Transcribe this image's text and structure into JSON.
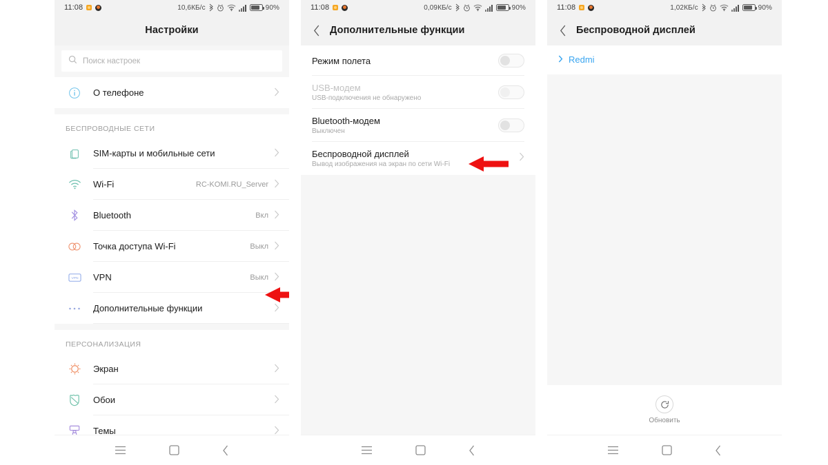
{
  "statusbar": {
    "time": "11:08",
    "battery_pct": "90%",
    "net_speed_1": "10,6КБ/c",
    "net_speed_2": "0,09КБ/c",
    "net_speed_3": "1,02КБ/c",
    "icons": [
      "bluetooth-icon",
      "alarm-icon",
      "wifi-icon",
      "signal-icon",
      "battery-icon"
    ]
  },
  "panel1": {
    "title": "Настройки",
    "search_placeholder": "Поиск настроек",
    "about": {
      "label": "О телефоне",
      "icon": "info-icon",
      "value": "",
      "chevron": "›"
    },
    "section_wireless": "БЕСПРОВОДНЫЕ СЕТИ",
    "wireless_items": [
      {
        "label": "SIM-карты и мобильные сети",
        "value": "",
        "icon": "sim-card-icon"
      },
      {
        "label": "Wi-Fi",
        "value": "RC-KOMI.RU_Server",
        "icon": "wifi-icon"
      },
      {
        "label": "Bluetooth",
        "value": "Вкл",
        "icon": "bluetooth-icon"
      },
      {
        "label": "Точка доступа Wi-Fi",
        "value": "Выкл",
        "icon": "hotspot-icon"
      },
      {
        "label": "VPN",
        "value": "Выкл",
        "icon": "vpn-icon"
      },
      {
        "label": "Дополнительные функции",
        "value": "",
        "icon": "more-dots-icon"
      }
    ],
    "section_personalization": "ПЕРСОНАЛИЗАЦИЯ",
    "personalization_items": [
      {
        "label": "Экран",
        "value": "",
        "icon": "display-icon"
      },
      {
        "label": "Обои",
        "value": "",
        "icon": "wallpaper-icon"
      },
      {
        "label": "Темы",
        "value": "",
        "icon": "themes-icon"
      }
    ]
  },
  "panel2": {
    "title": "Дополнительные функции",
    "back_icon": "chevron-left-icon",
    "rows": [
      {
        "title": "Режим полета",
        "subtitle": "",
        "control": "toggle",
        "state": "off",
        "dim": false
      },
      {
        "title": "USB-модем",
        "subtitle": "USB-подключения не обнаружено",
        "control": "toggle",
        "state": "off",
        "dim": true
      },
      {
        "title": "Bluetooth-модем",
        "subtitle": "Выключен",
        "control": "toggle",
        "state": "off",
        "dim": false
      },
      {
        "title": "Беспроводной дисплей",
        "subtitle": "Вывод изображения на экран по сети Wi-Fi",
        "control": "chevron",
        "state": "",
        "dim": false
      }
    ]
  },
  "panel3": {
    "title": "Беспроводной дисплей",
    "back_icon": "chevron-left-icon",
    "device": {
      "name": "Redmi",
      "chevron": "›"
    },
    "refresh": {
      "label": "Обновить",
      "icon": "refresh-icon"
    }
  },
  "navbar": {
    "menu_icon": "menu-icon",
    "home_icon": "home-square-icon",
    "back_icon": "back-chevron-icon"
  },
  "annotations": {
    "arrow_color": "#ee1111",
    "arrow_1_target": "Дополнительные функции",
    "arrow_2_target": "Беспроводной дисплей"
  }
}
